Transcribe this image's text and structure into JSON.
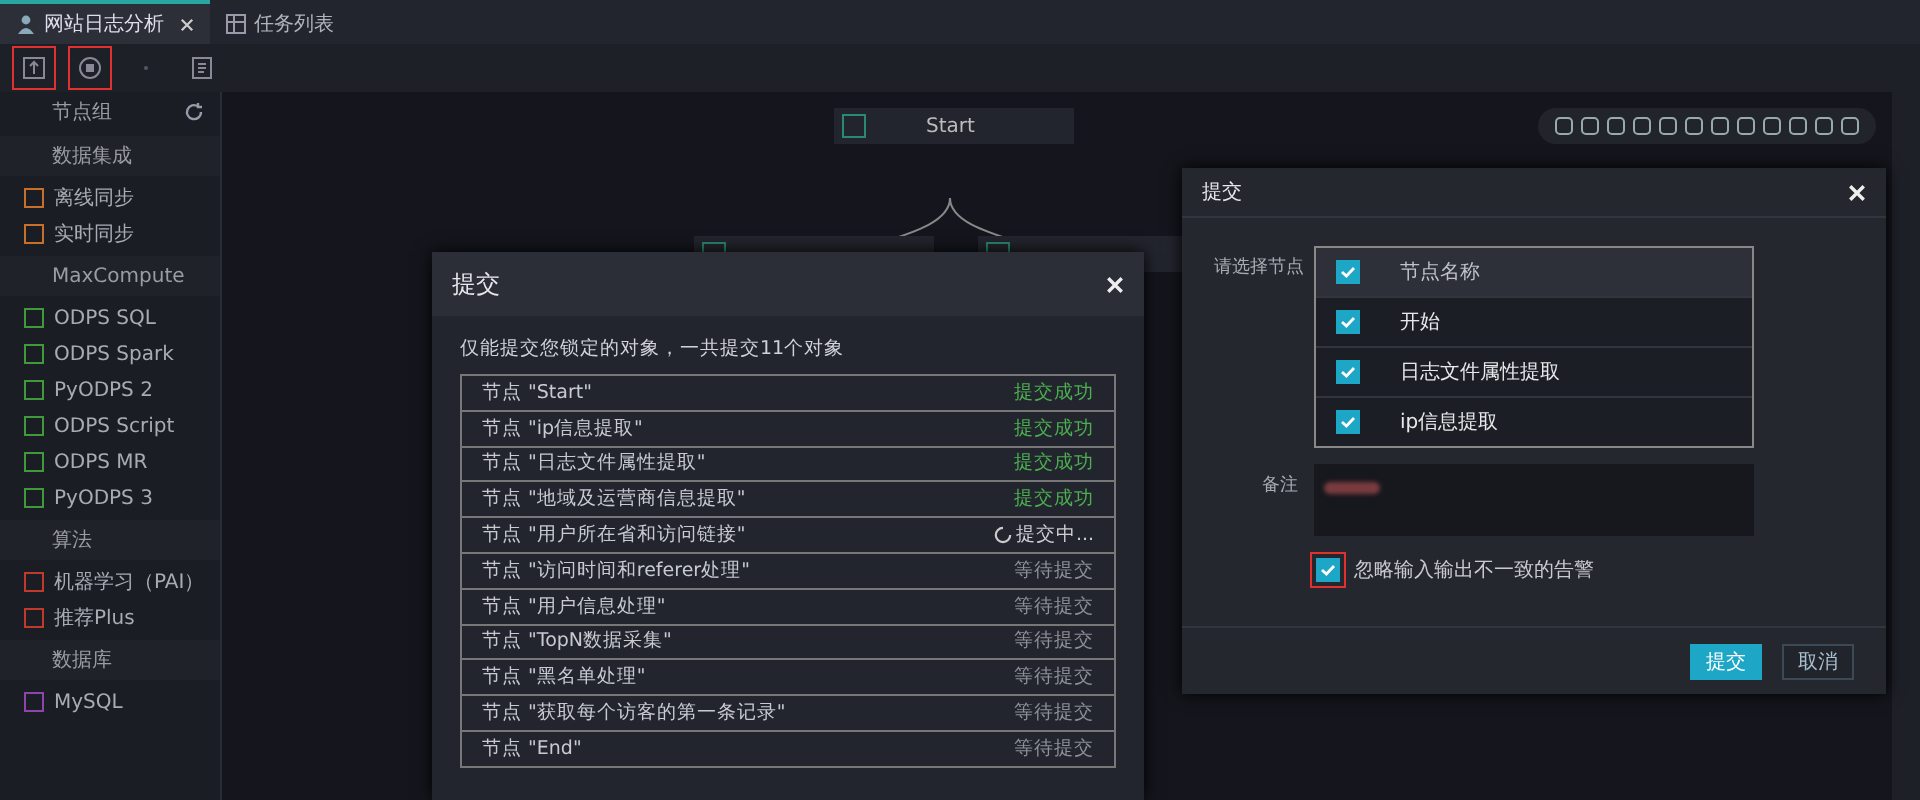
{
  "tabs": [
    {
      "label": "网站日志分析",
      "selected": true,
      "closable": true
    },
    {
      "label": "任务列表",
      "selected": false,
      "closable": false
    }
  ],
  "toolbar": [
    {
      "highlighted": true
    },
    {
      "highlighted": true
    },
    {
      "highlighted": false
    },
    {
      "highlighted": false
    }
  ],
  "sidebar": {
    "title": "节点组",
    "groups": [
      {
        "title": "数据集成",
        "color": "#c8702a",
        "items": [
          "离线同步",
          "实时同步"
        ]
      },
      {
        "title": "MaxCompute",
        "color": "#3f9a3a",
        "items": [
          "ODPS SQL",
          "ODPS Spark",
          "PyODPS 2",
          "ODPS Script",
          "ODPS MR",
          "PyODPS 3"
        ]
      },
      {
        "title": "算法",
        "color": "#c0392b",
        "items": [
          "机器学习（PAI）",
          "推荐Plus"
        ]
      },
      {
        "title": "数据库",
        "color": "#8e44ad",
        "items": [
          "MySQL"
        ]
      }
    ]
  },
  "canvas": {
    "start_node": "Start"
  },
  "submit_dialog": {
    "title": "提交",
    "note": "仅能提交您锁定的对象，一共提交11个对象",
    "rows": [
      {
        "name": "节点 \"Start\"",
        "status": "提交成功",
        "kind": "success"
      },
      {
        "name": "节点 \"ip信息提取\"",
        "status": "提交成功",
        "kind": "success"
      },
      {
        "name": "节点 \"日志文件属性提取\"",
        "status": "提交成功",
        "kind": "success"
      },
      {
        "name": "节点 \"地域及运营商信息提取\"",
        "status": "提交成功",
        "kind": "success"
      },
      {
        "name": "节点 \"用户所在省和访问链接\"",
        "status": "提交中...",
        "kind": "running"
      },
      {
        "name": "节点 \"访问时间和referer处理\"",
        "status": "等待提交",
        "kind": "waiting"
      },
      {
        "name": "节点 \"用户信息处理\"",
        "status": "等待提交",
        "kind": "waiting"
      },
      {
        "name": "节点 \"TopN数据采集\"",
        "status": "等待提交",
        "kind": "waiting"
      },
      {
        "name": "节点 \"黑名单处理\"",
        "status": "等待提交",
        "kind": "waiting"
      },
      {
        "name": "节点 \"获取每个访客的第一条记录\"",
        "status": "等待提交",
        "kind": "waiting"
      },
      {
        "name": "节点 \"End\"",
        "status": "等待提交",
        "kind": "waiting"
      }
    ]
  },
  "node_dialog": {
    "title": "提交",
    "select_label": "请选择节点",
    "header": {
      "label": "节点名称",
      "checked": true
    },
    "nodes": [
      {
        "label": "开始",
        "checked": true
      },
      {
        "label": "日志文件属性提取",
        "checked": true
      },
      {
        "label": "ip信息提取",
        "checked": true
      }
    ],
    "remark_label": "备注",
    "ignore": {
      "label": "忽略输入输出不一致的告警",
      "checked": true,
      "highlighted": true
    },
    "buttons": [
      {
        "label": "提交",
        "kind": "primary"
      },
      {
        "label": "取消",
        "kind": "secondary"
      }
    ]
  }
}
